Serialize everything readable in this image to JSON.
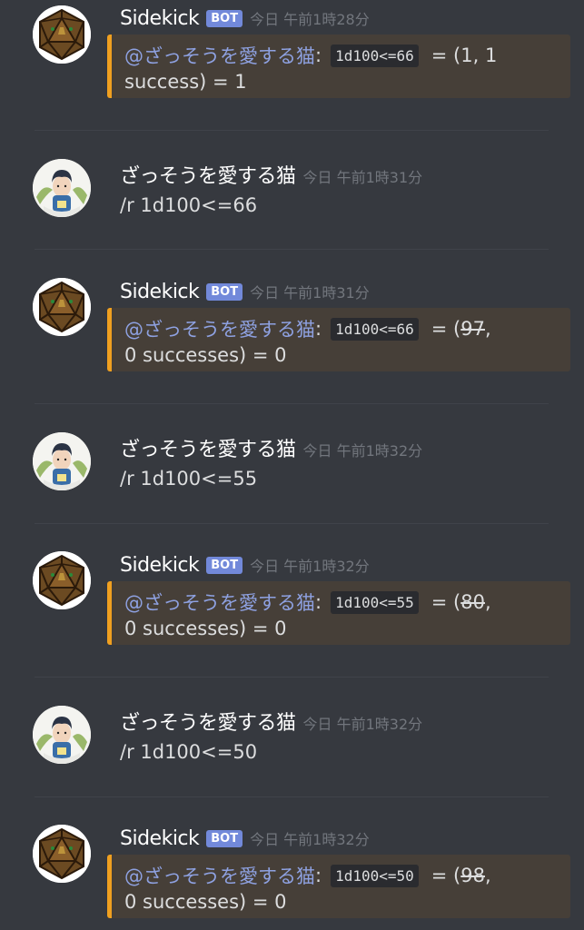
{
  "messages": [
    {
      "username": "Sidekick",
      "bot": true,
      "bot_label": "BOT",
      "timestamp": "今日 午前1時28分",
      "mention": "@ざっそうを愛する猫",
      "colon": ":",
      "code": "1d100<=66",
      "result_pre": "= (",
      "roll": "1",
      "result_post": ", 1",
      "line2": "success) = 1"
    },
    {
      "username": "ざっそうを愛する猫",
      "bot": false,
      "timestamp": "今日 午前1時31分",
      "text": "/r 1d100<=66"
    },
    {
      "username": "Sidekick",
      "bot": true,
      "bot_label": "BOT",
      "timestamp": "今日 午前1時31分",
      "mention": "@ざっそうを愛する猫",
      "colon": ":",
      "code": "1d100<=66",
      "result_pre": "= (",
      "roll": "97",
      "result_post": ",",
      "line2": "0 successes) = 0"
    },
    {
      "username": "ざっそうを愛する猫",
      "bot": false,
      "timestamp": "今日 午前1時32分",
      "text": "/r 1d100<=55"
    },
    {
      "username": "Sidekick",
      "bot": true,
      "bot_label": "BOT",
      "timestamp": "今日 午前1時32分",
      "mention": "@ざっそうを愛する猫",
      "colon": ":",
      "code": "1d100<=55",
      "result_pre": "= (",
      "roll": "80",
      "result_post": ",",
      "line2": "0 successes) = 0"
    },
    {
      "username": "ざっそうを愛する猫",
      "bot": false,
      "timestamp": "今日 午前1時32分",
      "text": "/r 1d100<=50"
    },
    {
      "username": "Sidekick",
      "bot": true,
      "bot_label": "BOT",
      "timestamp": "今日 午前1時32分",
      "mention": "@ざっそうを愛する猫",
      "colon": ":",
      "code": "1d100<=50",
      "result_pre": "= (",
      "roll": "98",
      "result_post": ",",
      "line2": "0 successes) = 0"
    }
  ],
  "colors": {
    "background": "#36393f",
    "bot_badge": "#7289da",
    "embed_accent": "#f0a020",
    "mention": "#8ea1e1"
  },
  "icons": {
    "bot_avatar": "d20-die-icon",
    "user_avatar": "cat-lover-character-icon"
  }
}
